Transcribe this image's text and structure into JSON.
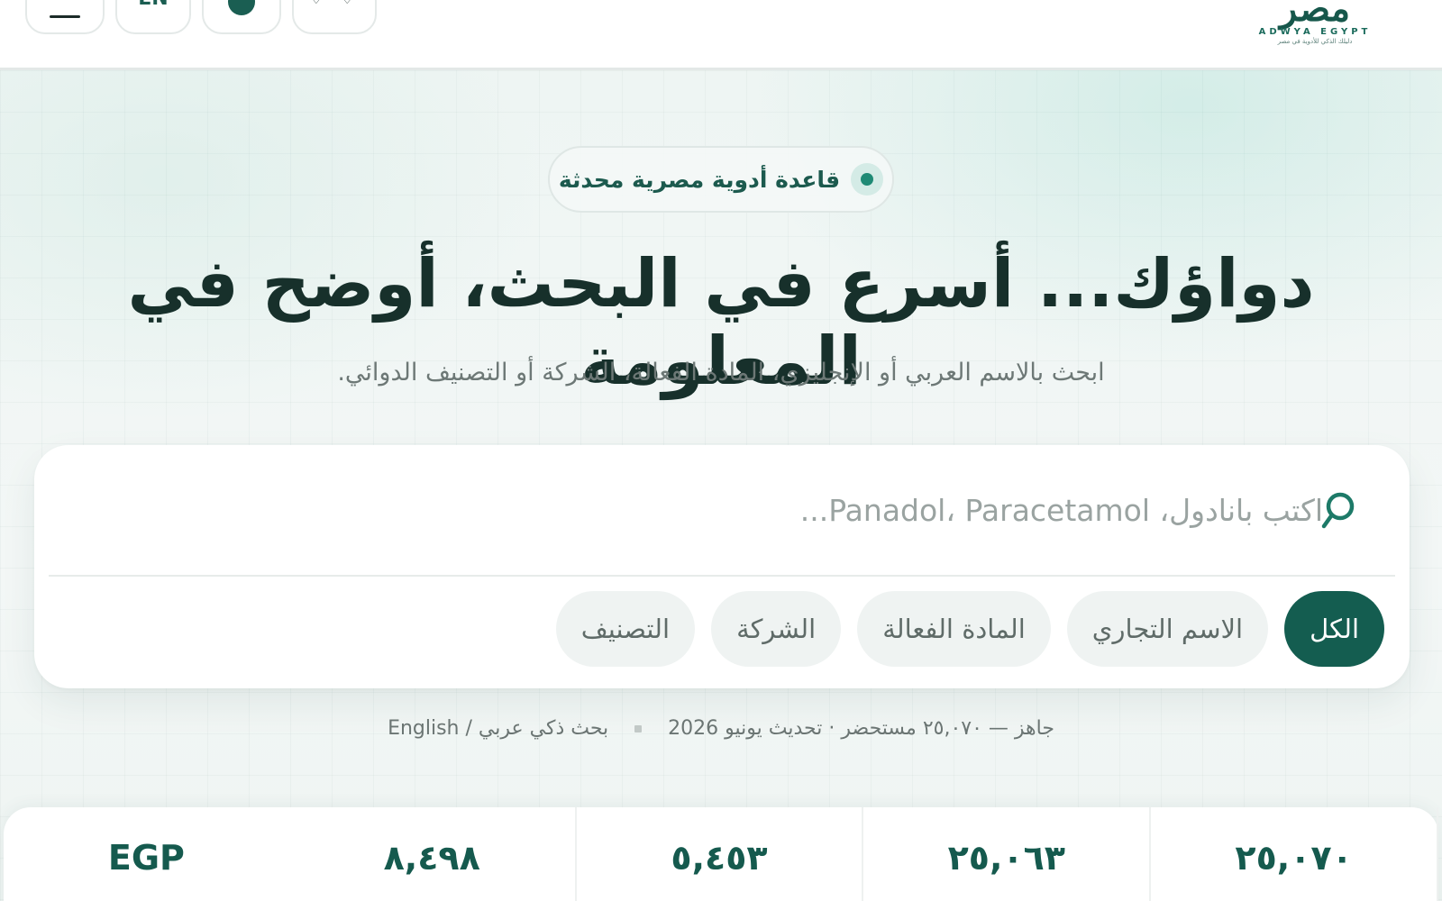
{
  "header": {
    "lang_label": "EN",
    "logo_mark": "مصر",
    "logo_en": "ADWYA EGYPT",
    "logo_tagline": "دليلك الذكي للأدوية في مصر"
  },
  "hero": {
    "badge": "قاعدة أدوية مصرية محدثة",
    "title": "دواؤك... أسرع في البحث، أوضح في المعلومة",
    "subtitle": "ابحث بالاسم العربي أو الإنجليزي، المادة الفعالة، الشركة أو التصنيف الدوائي."
  },
  "search": {
    "placeholder": "اكتب بانادول، Panadol، Paracetamol...",
    "value": "",
    "filters": [
      {
        "label": "الكل",
        "active": true
      },
      {
        "label": "الاسم التجاري",
        "active": false
      },
      {
        "label": "المادة الفعالة",
        "active": false
      },
      {
        "label": "الشركة",
        "active": false
      },
      {
        "label": "التصنيف",
        "active": false
      }
    ]
  },
  "status": {
    "left": "جاهز — ٢٥,٠٧٠ مستحضر · تحديث يونيو 2026",
    "right": "بحث ذكي عربي / English"
  },
  "stats": [
    {
      "value": "٢٥,٠٧٠"
    },
    {
      "value": "٢٥,٠٦٣"
    },
    {
      "value": "٥,٤٥٣"
    },
    {
      "value": "٨,٤٩٨"
    },
    {
      "value": "EGP"
    }
  ],
  "colors": {
    "accent": "#145d50",
    "chip_bg": "#eff3f2",
    "title": "#17302b"
  }
}
